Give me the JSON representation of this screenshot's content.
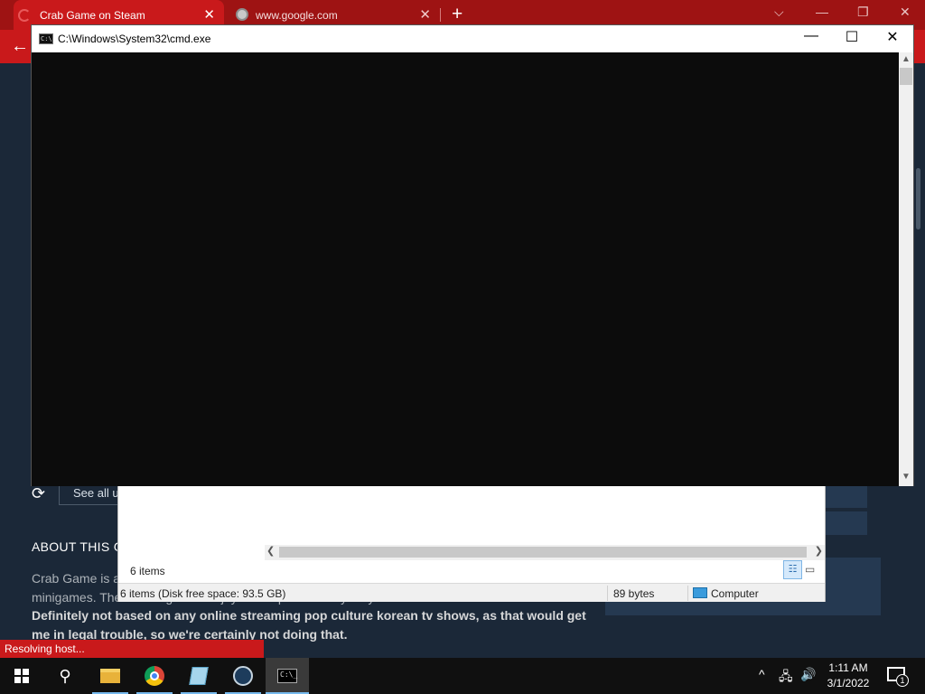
{
  "browser": {
    "tabs": [
      {
        "label": "Crab Game on Steam",
        "active": true
      },
      {
        "label": "www.google.com",
        "active": false
      }
    ],
    "new_tab_symbol": "+",
    "close_symbol": "✕",
    "back_symbol": "←",
    "window_controls": [
      "⌵",
      "—",
      "❐",
      "✕"
    ],
    "status_text": "Resolving host...",
    "accent": "#c9191b"
  },
  "steam_page": {
    "see_all_label": "See all u",
    "about_heading": "ABOUT THIS G",
    "about_p1": "Crab Game is a first-person multiplayer game where you compete with your friends in different minigames. The winner gets to enjoy all the prize money they've won.",
    "about_p2": "Definitely not based on any online streaming pop culture korean tv shows, as that would get me in legal trouble, so we're certainly not doing that."
  },
  "explorer": {
    "items_count": "6 items",
    "status_left": "6 items (Disk free space: 93.5 GB)",
    "status_size": "89 bytes",
    "status_location": "Computer"
  },
  "cmd": {
    "title": "C:\\Windows\\System32\\cmd.exe",
    "icon_text": "C:\\",
    "controls": [
      "—",
      "☐",
      "✕"
    ],
    "background": "#0c0c0c"
  },
  "taskbar": {
    "search_symbol": "⚲",
    "cmd_icon_text": "C:\\_",
    "tray_chevron": "^",
    "tray_network": "🖧",
    "tray_volume": "🔊",
    "time": "1:11 AM",
    "date": "3/1/2022",
    "notifications_count": "1"
  }
}
